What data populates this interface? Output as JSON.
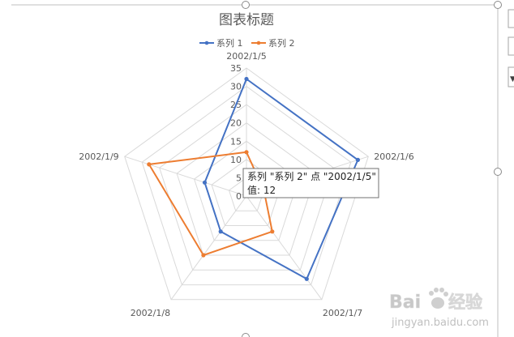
{
  "chart_data": {
    "type": "radar",
    "title": "图表标题",
    "categories": [
      "2002/1/5",
      "2002/1/6",
      "2002/1/7",
      "2002/1/8",
      "2002/1/9"
    ],
    "series": [
      {
        "name": "系列 1",
        "values": [
          32,
          32,
          28,
          12,
          12
        ],
        "color": "#4472c4"
      },
      {
        "name": "系列 2",
        "values": [
          12,
          5,
          12,
          20,
          28
        ],
        "color": "#ed7d31"
      }
    ],
    "radial_ticks": [
      0,
      5,
      10,
      15,
      20,
      25,
      30,
      35
    ],
    "r_range": [
      0,
      35
    ],
    "grid": true,
    "legend": "top"
  },
  "tooltip": {
    "line1": "系列 \"系列 2\" 点 \"2002/1/5\"",
    "line2": "值: 12"
  },
  "watermark": {
    "brand_a": "Bai",
    "brand_b": "经验",
    "url": "jingyan.baidu.com"
  },
  "colors": {
    "grid": "#d9d9d9",
    "text": "#595959",
    "frame": "#bfbfbf"
  }
}
